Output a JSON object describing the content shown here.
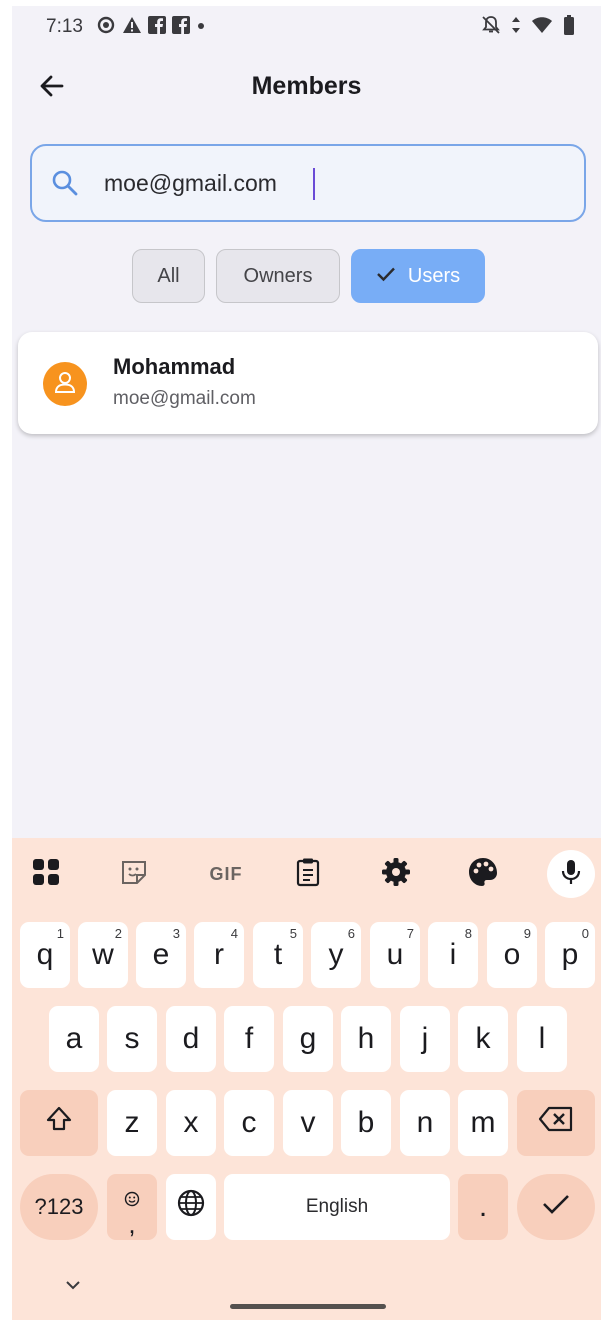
{
  "status_bar": {
    "time": "7:13",
    "left_icons": [
      "settings-gear-icon",
      "warning-icon",
      "facebook-icon",
      "facebook-icon",
      "notification-dot-icon"
    ],
    "right_icons": [
      "bell-off-icon",
      "data-arrows-icon",
      "wifi-icon",
      "battery-icon"
    ]
  },
  "app_bar": {
    "title": "Members",
    "back_icon": "arrow-left-icon"
  },
  "search": {
    "value": "moe@gmail.com",
    "icon": "search-icon"
  },
  "filters": {
    "options": [
      {
        "label": "All",
        "selected": false
      },
      {
        "label": "Owners",
        "selected": false
      },
      {
        "label": "Users",
        "selected": true
      }
    ]
  },
  "members": [
    {
      "name": "Mohammad",
      "email": "moe@gmail.com",
      "avatar_color": "#f7931e"
    }
  ],
  "keyboard": {
    "toolbar": [
      "apps-grid-icon",
      "sticker-icon",
      "GIF",
      "clipboard-icon",
      "settings-icon",
      "palette-icon",
      "mic-icon"
    ],
    "row1": [
      {
        "k": "q",
        "s": "1"
      },
      {
        "k": "w",
        "s": "2"
      },
      {
        "k": "e",
        "s": "3"
      },
      {
        "k": "r",
        "s": "4"
      },
      {
        "k": "t",
        "s": "5"
      },
      {
        "k": "y",
        "s": "6"
      },
      {
        "k": "u",
        "s": "7"
      },
      {
        "k": "i",
        "s": "8"
      },
      {
        "k": "o",
        "s": "9"
      },
      {
        "k": "p",
        "s": "0"
      }
    ],
    "row2": [
      "a",
      "s",
      "d",
      "f",
      "g",
      "h",
      "j",
      "k",
      "l"
    ],
    "row3": [
      "z",
      "x",
      "c",
      "v",
      "b",
      "n",
      "m"
    ],
    "symbols_label": "?123",
    "emoji_comma_label": ",",
    "space_label": "English",
    "period_label": ".",
    "colors": {
      "keyboard_bg": "#fde4d8",
      "function_key": "#f8cfbc",
      "accent_blue": "#78adf6"
    }
  }
}
